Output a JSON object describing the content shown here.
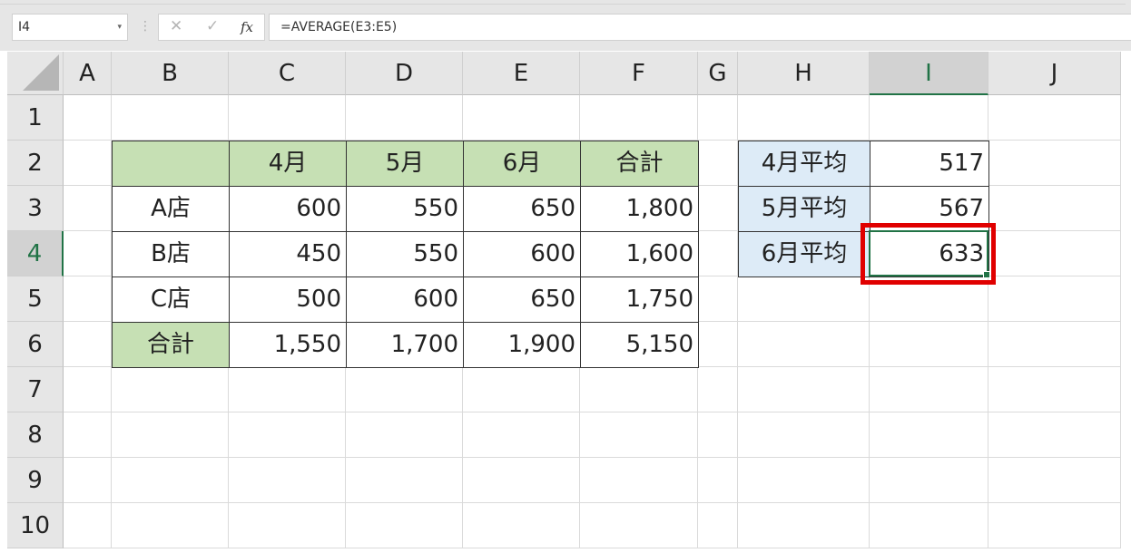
{
  "formula_bar": {
    "name_box": "I4",
    "cancel_icon": "✕",
    "enter_icon": "✓",
    "fx_label": "fx",
    "formula": "=AVERAGE(E3:E5)"
  },
  "columns": [
    "A",
    "B",
    "C",
    "D",
    "E",
    "F",
    "G",
    "H",
    "I",
    "J"
  ],
  "selected_column": "I",
  "rows": [
    "1",
    "2",
    "3",
    "4",
    "5",
    "6",
    "7",
    "8",
    "9",
    "10"
  ],
  "selected_row": "4",
  "sales_table": {
    "headers": [
      "",
      "4月",
      "5月",
      "6月",
      "合計"
    ],
    "rows": [
      [
        "A店",
        "600",
        "550",
        "650",
        "1,800"
      ],
      [
        "B店",
        "450",
        "550",
        "600",
        "1,600"
      ],
      [
        "C店",
        "500",
        "600",
        "650",
        "1,750"
      ],
      [
        "合計",
        "1,550",
        "1,700",
        "1,900",
        "5,150"
      ]
    ]
  },
  "average_table": {
    "rows": [
      [
        "4月平均",
        "517"
      ],
      [
        "5月平均",
        "567"
      ],
      [
        "6月平均",
        "633"
      ]
    ]
  },
  "colors": {
    "header_green": "#c6e0b4",
    "label_blue": "#ddebf7",
    "selection_green": "#217346",
    "highlight_red": "#e00000"
  }
}
